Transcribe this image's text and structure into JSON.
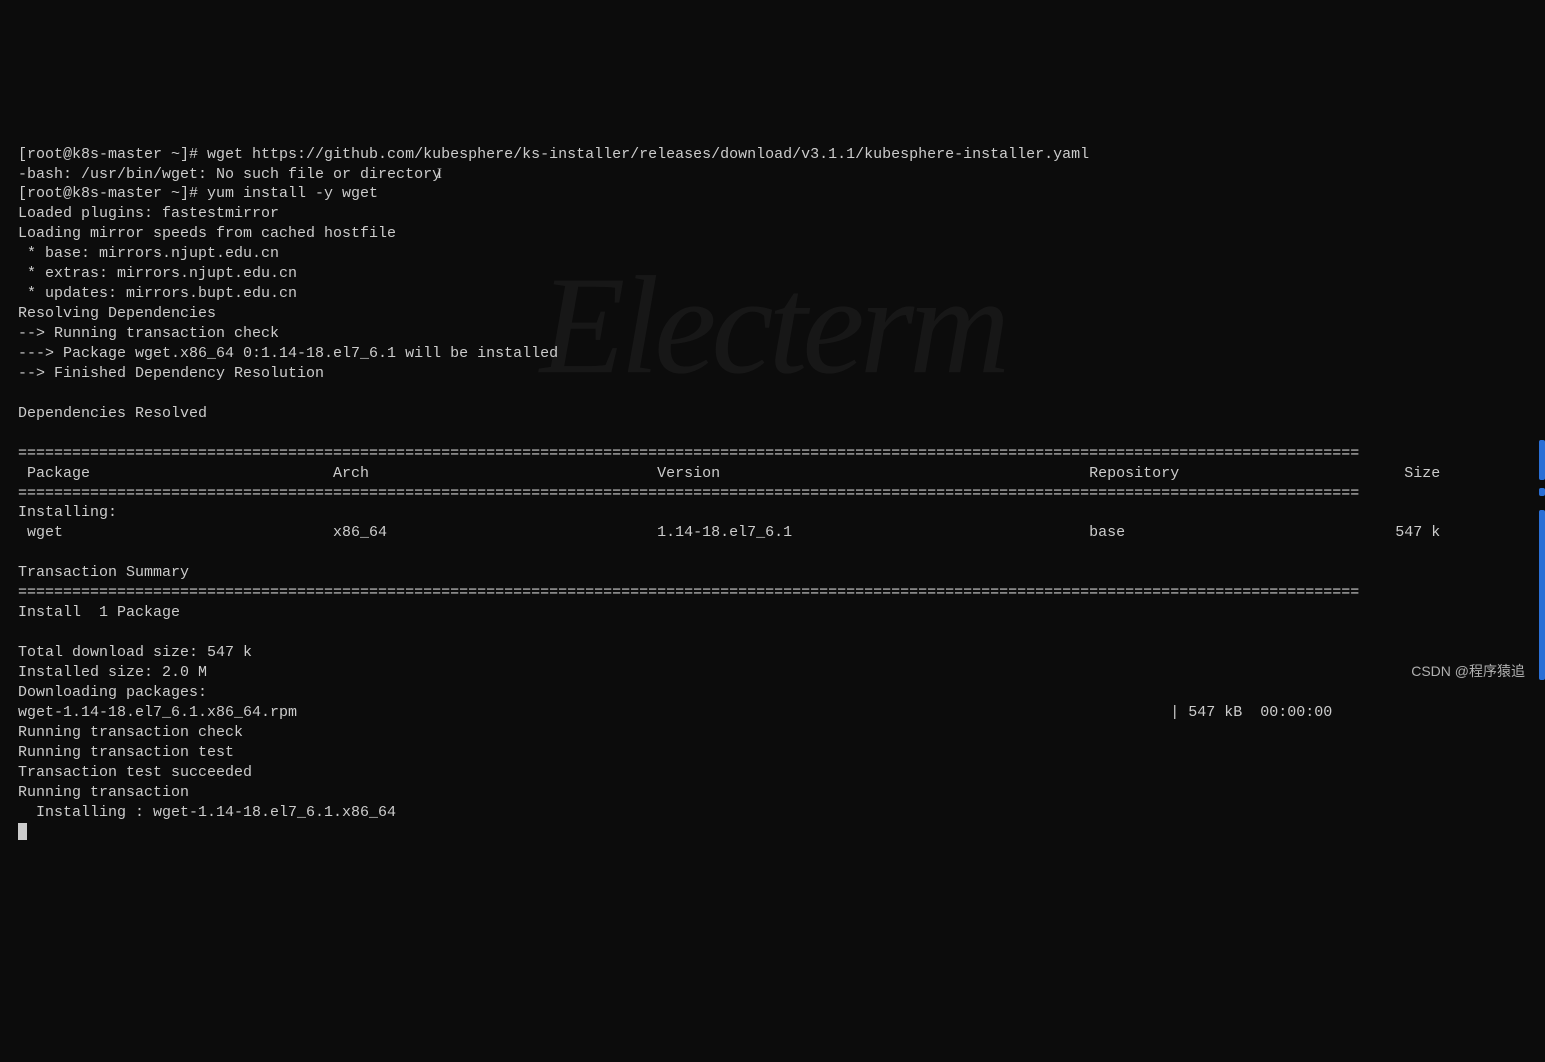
{
  "watermark": "Electerm",
  "csdn": "CSDN @程序猿追",
  "terminal": {
    "line1": "[root@k8s-master ~]# wget https://github.com/kubesphere/ks-installer/releases/download/v3.1.1/kubesphere-installer.yaml",
    "line2": "-bash: /usr/bin/wget: No such file or directory",
    "line3": "[root@k8s-master ~]# yum install -y wget",
    "line4": "Loaded plugins: fastestmirror",
    "line5": "Loading mirror speeds from cached hostfile",
    "line6": " * base: mirrors.njupt.edu.cn",
    "line7": " * extras: mirrors.njupt.edu.cn",
    "line8": " * updates: mirrors.bupt.edu.cn",
    "line9": "Resolving Dependencies",
    "line10": "--> Running transaction check",
    "line11": "---> Package wget.x86_64 0:1.14-18.el7_6.1 will be installed",
    "line12": "--> Finished Dependency Resolution",
    "line13": "",
    "line14": "Dependencies Resolved",
    "line15": "",
    "separator": "=====================================================================================================================================================",
    "header": " Package                           Arch                                Version                                         Repository                         Size",
    "installing": "Installing:",
    "pkgrow": " wget                              x86_64                              1.14-18.el7_6.1                                 base                              547 k",
    "line20": "",
    "line21": "Transaction Summary",
    "line23": "Install  1 Package",
    "line24": "",
    "line25": "Total download size: 547 k",
    "line26": "Installed size: 2.0 M",
    "line27": "Downloading packages:",
    "line28": "wget-1.14-18.el7_6.1.x86_64.rpm                                                                                                 | 547 kB  00:00:00",
    "line29": "Running transaction check",
    "line30": "Running transaction test",
    "line31": "Transaction test succeeded",
    "line32": "Running transaction",
    "line33": "  Installing : wget-1.14-18.el7_6.1.x86_64"
  },
  "text_cursor": "I"
}
